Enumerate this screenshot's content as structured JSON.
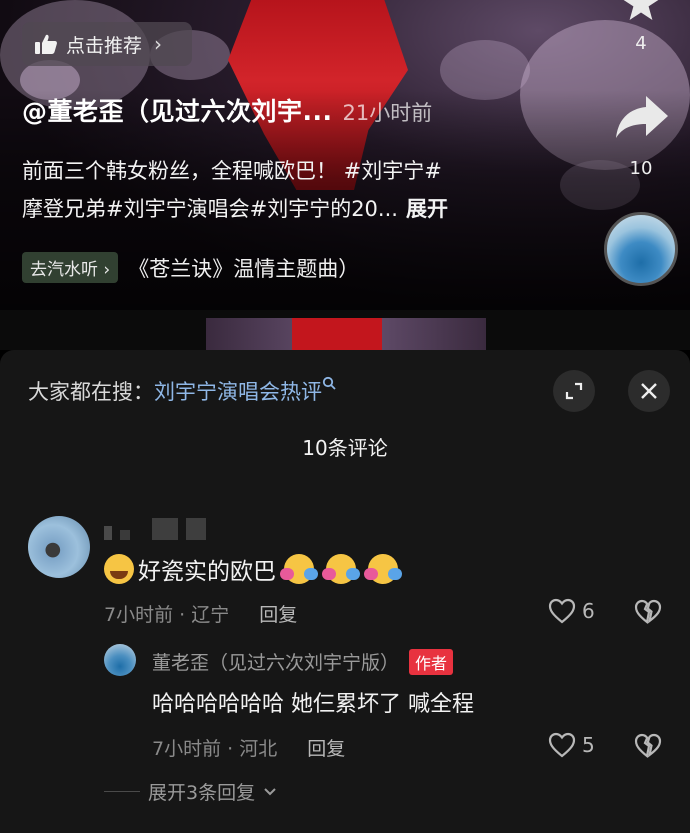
{
  "video": {
    "recommend_label": "点击推荐",
    "star_count": "4",
    "share_count": "10",
    "author": "@董老歪（见过六次刘宇...",
    "time_ago": "21小时前",
    "caption_line1": "前面三个韩女粉丝，全程喊欧巴！ #刘宇宁#",
    "caption_line2": "摩登兄弟#刘宇宁演唱会#刘宇宁的20...",
    "caption_expand": "展开",
    "music_tag": "去汽水听",
    "music_title": "《苍兰诀》温情主题曲）"
  },
  "comments": {
    "search_prefix": "大家都在搜：",
    "search_term": "刘宇宁演唱会热评",
    "count_title": "10条评论",
    "first": {
      "text": "好瓷实的欧巴",
      "time_location": "7小时前 · 辽宁",
      "reply_label": "回复",
      "likes": "6"
    },
    "reply": {
      "author": "董老歪（见过六次刘宇宁版）",
      "badge": "作者",
      "text": "哈哈哈哈哈哈 她仨累坏了 喊全程",
      "time_location": "7小时前 · 河北",
      "reply_label": "回复",
      "likes": "5"
    },
    "expand_replies": "展开3条回复"
  },
  "icons": {
    "thumb": "thumbs-up-icon",
    "chevron": "chevron-right-icon",
    "star": "star-icon",
    "share": "share-arrow-icon",
    "search": "search-icon",
    "expand": "expand-icon",
    "close": "close-icon",
    "heart": "heart-icon",
    "broken_heart": "broken-heart-icon"
  },
  "colors": {
    "link": "#8fb7e6",
    "badge": "#e8323f",
    "panel": "#161616"
  }
}
